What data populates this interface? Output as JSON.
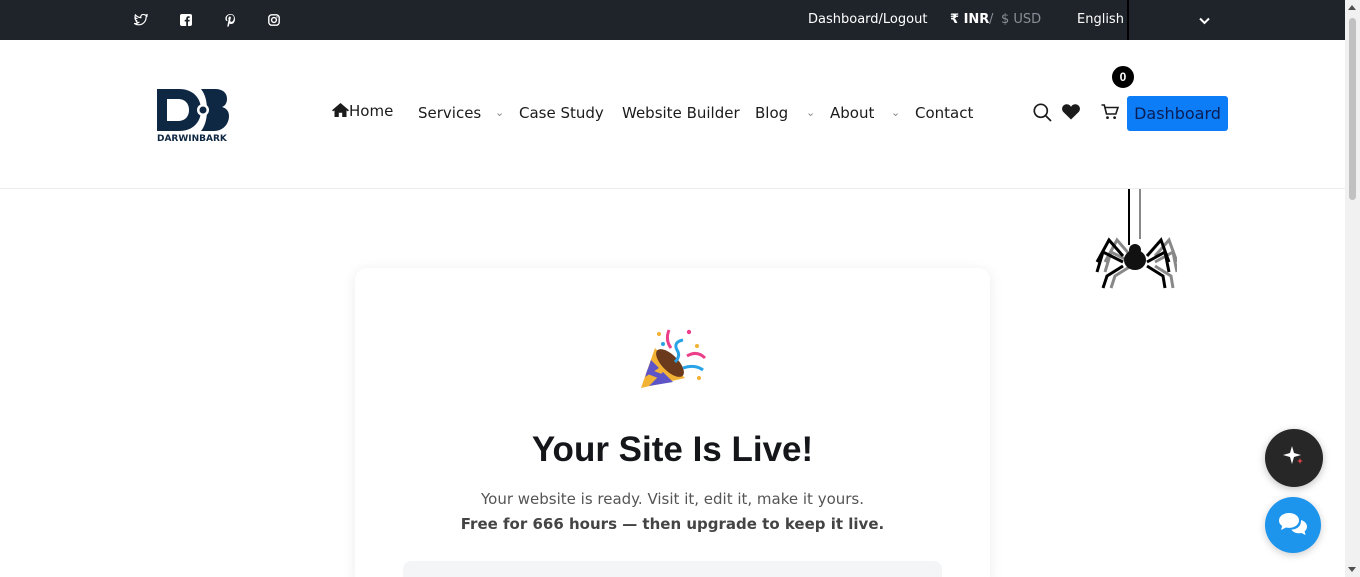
{
  "topbar": {
    "social": [
      {
        "icon": "twitter-icon"
      },
      {
        "icon": "facebook-icon"
      },
      {
        "icon": "pinterest-icon"
      },
      {
        "icon": "instagram-icon"
      }
    ],
    "dashboard_link": "Dashboard",
    "separator": "/",
    "logout_link": "Logout",
    "currency_inr": "₹ INR",
    "currency_sep": "/",
    "currency_usd": "$ USD",
    "language": "English",
    "language_dropdown_icon": "chevron-down-icon"
  },
  "header": {
    "logo_icon": "darwinbark-logo",
    "logo_text": "DARWINBARK",
    "nav": {
      "home": "Home",
      "services": "Services",
      "case_study": "Case Study",
      "website_builder": "Website Builder",
      "blog": "Blog",
      "about": "About",
      "contact": "Contact"
    },
    "caret": "⌄",
    "cart_count": "0",
    "dashboard_button": "Dashboard"
  },
  "card": {
    "icon": "party-popper-icon",
    "title": "Your Site Is Live!",
    "subtitle": "Your website is ready. Visit it, edit it, make it yours.",
    "note": "Free for 666 hours — then upgrade to keep it live."
  },
  "colors": {
    "topbar_bg": "#1f232a",
    "accent_blue": "#0d7cf7",
    "chat_blue": "#1e95ec",
    "ai_dark": "#272727"
  }
}
